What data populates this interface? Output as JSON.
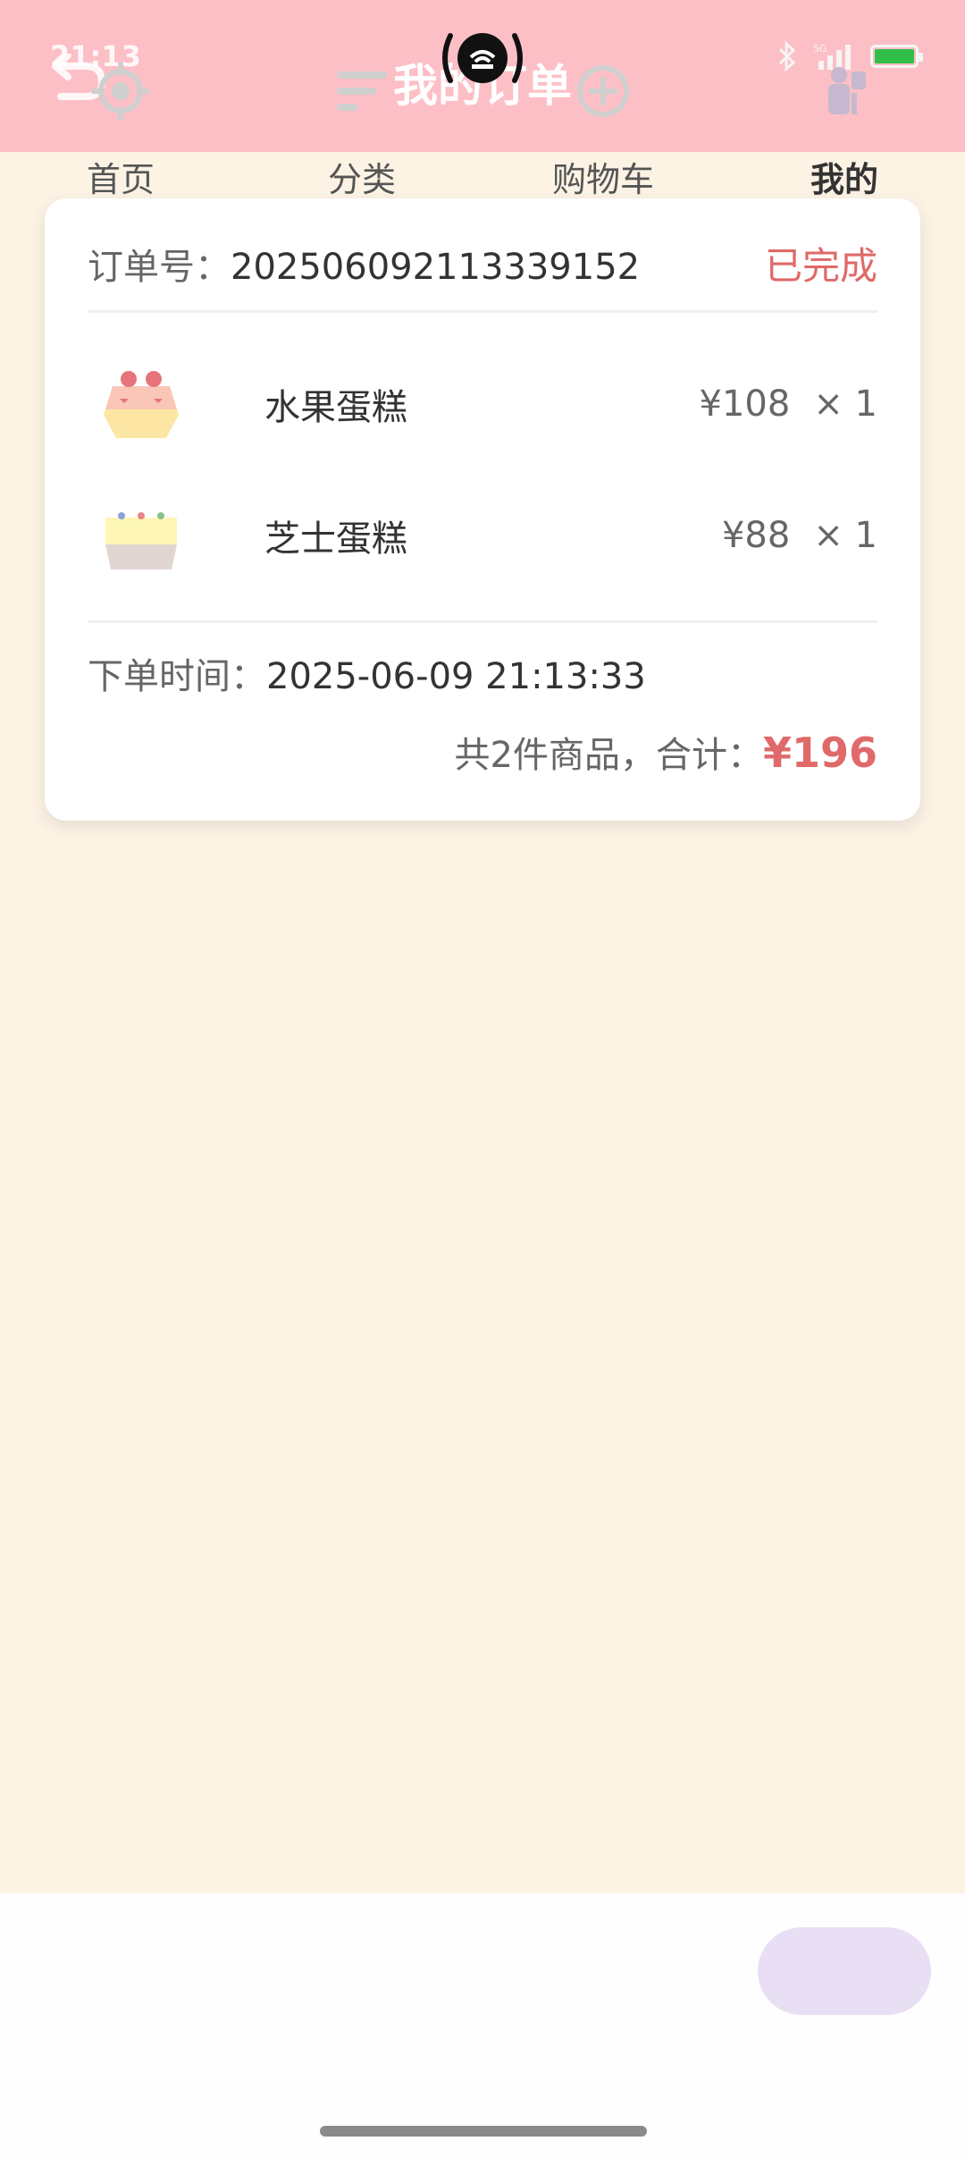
{
  "status_bar": {
    "time": "21:13",
    "network": "5G"
  },
  "header": {
    "title": "我的订单"
  },
  "order": {
    "order_no_label": "订单号：",
    "order_no": "202506092113339152",
    "status": "已完成",
    "items": [
      {
        "name": "水果蛋糕",
        "price": "¥108",
        "qty": "× 1"
      },
      {
        "name": "芝士蛋糕",
        "price": "¥88",
        "qty": "× 1"
      }
    ],
    "time_label": "下单时间：",
    "time": "2025-06-09 21:13:33",
    "summary_label": "共2件商品，合计：",
    "total": "¥196"
  },
  "tabbar": {
    "tabs": [
      {
        "label": "首页",
        "icon": "compass-icon"
      },
      {
        "label": "分类",
        "icon": "list-icon"
      },
      {
        "label": "购物车",
        "icon": "add-circle-icon"
      },
      {
        "label": "我的",
        "icon": "person-icon",
        "active": true
      }
    ]
  },
  "colors": {
    "header_bg": "#fdbfc6",
    "page_bg": "#fdf3e5",
    "accent_red": "#e06969",
    "active_tab_bg": "#e9dff5"
  }
}
